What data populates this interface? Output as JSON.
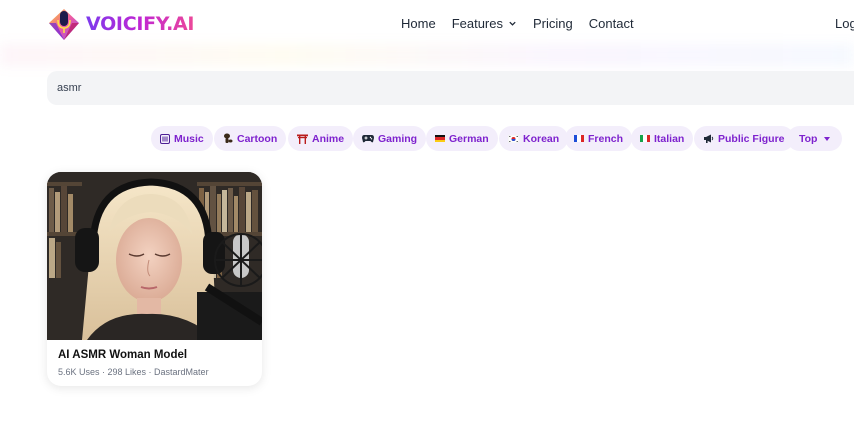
{
  "brand": {
    "name": "VOICIFY.AI"
  },
  "nav": {
    "home": "Home",
    "features": "Features",
    "pricing": "Pricing",
    "contact": "Contact",
    "login": "Log"
  },
  "search": {
    "value": "asmr"
  },
  "filters": {
    "music": {
      "label": "Music",
      "icon": "music-icon"
    },
    "cartoon": {
      "label": "Cartoon",
      "icon": "cartoon-icon"
    },
    "anime": {
      "label": "Anime",
      "icon": "torii-icon"
    },
    "gaming": {
      "label": "Gaming",
      "icon": "gamepad-icon"
    },
    "german": {
      "label": "German",
      "icon": "german-flag-icon"
    },
    "korean": {
      "label": "Korean",
      "icon": "korean-flag-icon"
    },
    "french": {
      "label": "French",
      "icon": "french-flag-icon"
    },
    "italian": {
      "label": "Italian",
      "icon": "italian-flag-icon"
    },
    "public_figure": {
      "label": "Public Figure",
      "icon": "megaphone-icon"
    },
    "sort": {
      "label": "Top"
    }
  },
  "results": [
    {
      "title": "AI ASMR Woman Model",
      "meta": "5.6K Uses · 298 Likes · DastardMater"
    }
  ],
  "colors": {
    "accent": "#7e22ce",
    "chip_bg": "#f3eefb",
    "search_bg": "#f3f4f6"
  }
}
